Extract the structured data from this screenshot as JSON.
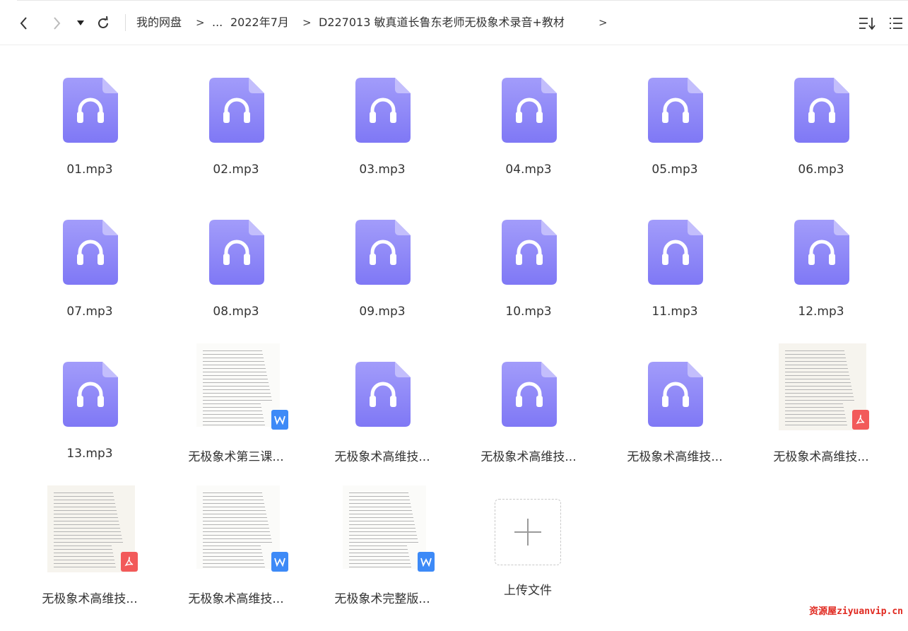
{
  "breadcrumb": {
    "root": "我的网盘",
    "ellipsis": "...",
    "parent": "2022年7月",
    "current": "D227013 敏真道长鲁东老师无极象术录音+教材",
    "sep": ">"
  },
  "files": [
    {
      "name": "01.mp3",
      "type": "audio"
    },
    {
      "name": "02.mp3",
      "type": "audio"
    },
    {
      "name": "03.mp3",
      "type": "audio"
    },
    {
      "name": "04.mp3",
      "type": "audio"
    },
    {
      "name": "05.mp3",
      "type": "audio"
    },
    {
      "name": "06.mp3",
      "type": "audio"
    },
    {
      "name": "07.mp3",
      "type": "audio"
    },
    {
      "name": "08.mp3",
      "type": "audio"
    },
    {
      "name": "09.mp3",
      "type": "audio"
    },
    {
      "name": "10.mp3",
      "type": "audio"
    },
    {
      "name": "11.mp3",
      "type": "audio"
    },
    {
      "name": "12.mp3",
      "type": "audio"
    },
    {
      "name": "13.mp3",
      "type": "audio"
    },
    {
      "name": "无极象术第三课...",
      "type": "word"
    },
    {
      "name": "无极象术高维技...",
      "type": "audio"
    },
    {
      "name": "无极象术高维技...",
      "type": "audio"
    },
    {
      "name": "无极象术高维技...",
      "type": "audio"
    },
    {
      "name": "无极象术高维技...",
      "type": "pdf"
    },
    {
      "name": "无极象术高维技...",
      "type": "pdf"
    },
    {
      "name": "无极象术高维技...",
      "type": "word"
    },
    {
      "name": "无极象术完整版...",
      "type": "word"
    }
  ],
  "upload": {
    "label": "上传文件"
  },
  "colors": {
    "audio": "#8a83f7",
    "word": "#3d8af7",
    "pdf": "#f25a5a"
  },
  "watermark": "资源屋ziyuanvip.cn"
}
